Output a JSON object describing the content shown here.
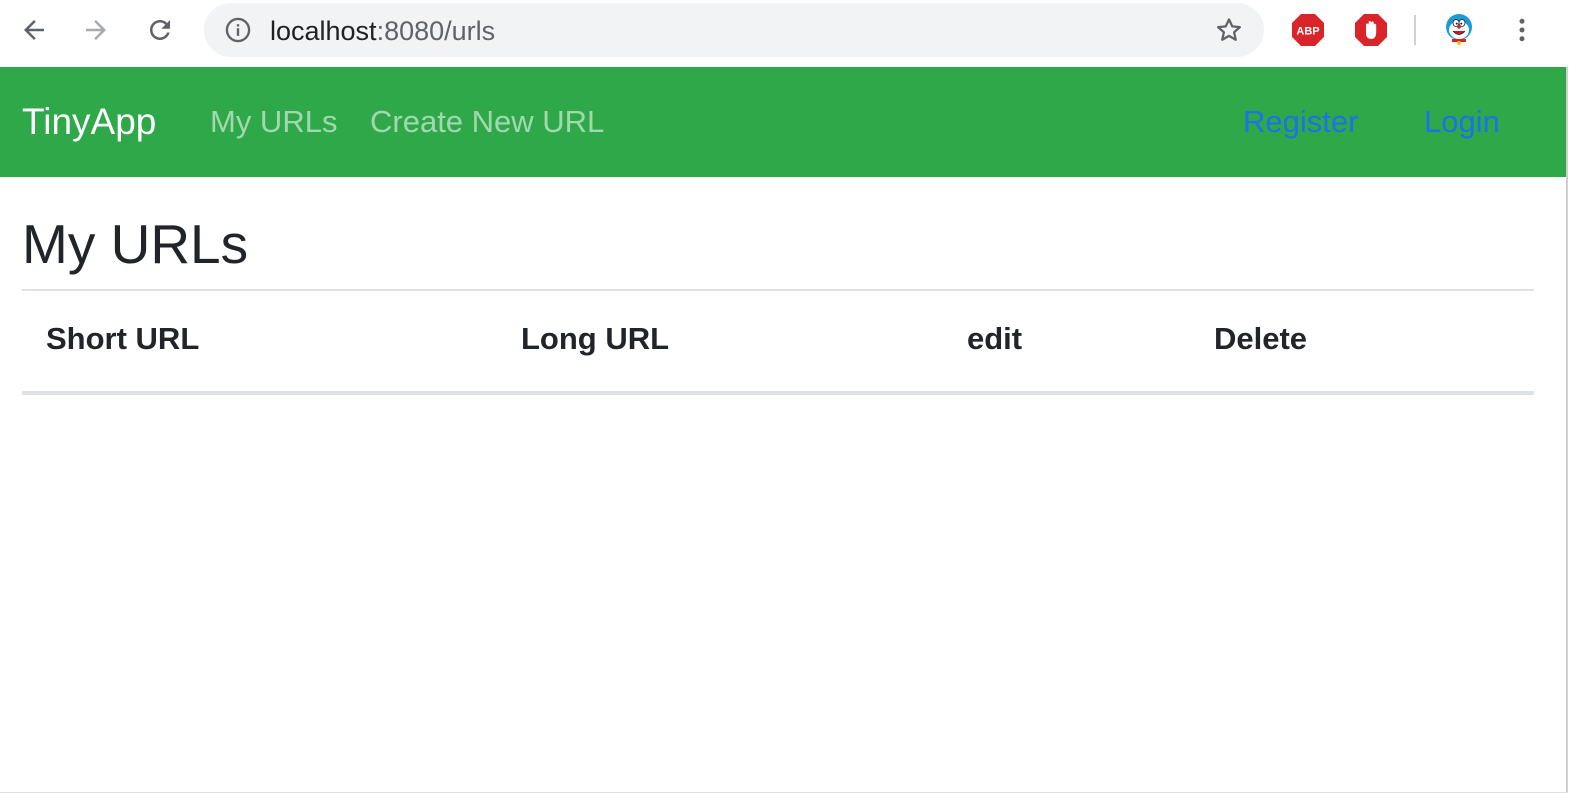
{
  "browser": {
    "url_host": "localhost",
    "url_path": ":8080/urls",
    "icons": {
      "back": "arrow-left-icon",
      "forward": "arrow-right-icon",
      "reload": "reload-icon",
      "info": "info-icon",
      "bookmark": "star-icon",
      "adblock": "abp-icon",
      "ublock": "stop-hand-icon",
      "profile": "avatar-icon",
      "menu": "kebab-menu-icon"
    },
    "adblock_label": "ABP"
  },
  "navbar": {
    "brand": "TinyApp",
    "links": [
      "My URLs",
      "Create New URL"
    ],
    "right_links": [
      "Register",
      "Login"
    ],
    "colors": {
      "background": "#2fa84a",
      "right_link": "#1a73e8"
    }
  },
  "main": {
    "title": "My URLs",
    "table": {
      "headers": [
        "Short URL",
        "Long URL",
        "edit",
        "Delete"
      ],
      "rows": []
    }
  }
}
